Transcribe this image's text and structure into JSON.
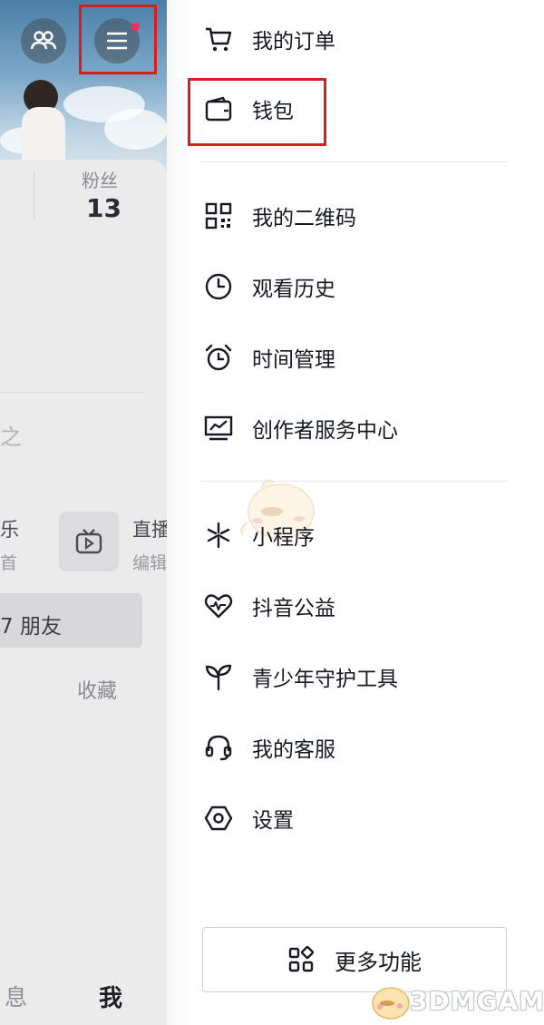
{
  "profile": {
    "fans_label": "粉丝",
    "fans_count": "13",
    "partial_glyph": "之",
    "music_title": "乐",
    "music_sub": "首",
    "live_title": "直播",
    "live_sub": "编辑",
    "friends_banner": "7 朋友",
    "tab_favorites": "收藏",
    "nav_messages": "息",
    "nav_me": "我"
  },
  "drawer": {
    "items": [
      {
        "label": "我的订单",
        "icon": "cart-icon"
      },
      {
        "label": "钱包",
        "icon": "wallet-icon"
      },
      {
        "label": "我的二维码",
        "icon": "qrcode-icon"
      },
      {
        "label": "观看历史",
        "icon": "clock-icon"
      },
      {
        "label": "时间管理",
        "icon": "alarm-clock-icon"
      },
      {
        "label": "创作者服务中心",
        "icon": "chart-monitor-icon"
      },
      {
        "label": "小程序",
        "icon": "mini-program-icon"
      },
      {
        "label": "抖音公益",
        "icon": "heart-wave-icon"
      },
      {
        "label": "青少年守护工具",
        "icon": "sprout-icon"
      },
      {
        "label": "我的客服",
        "icon": "headset-icon"
      },
      {
        "label": "设置",
        "icon": "hexagon-settings-icon"
      }
    ],
    "more_button": "更多功能"
  },
  "watermark": {
    "text": "3DMGAME"
  },
  "colors": {
    "highlight": "#d21f1f",
    "notification_dot": "#fe2c55",
    "text_primary": "#161823"
  }
}
